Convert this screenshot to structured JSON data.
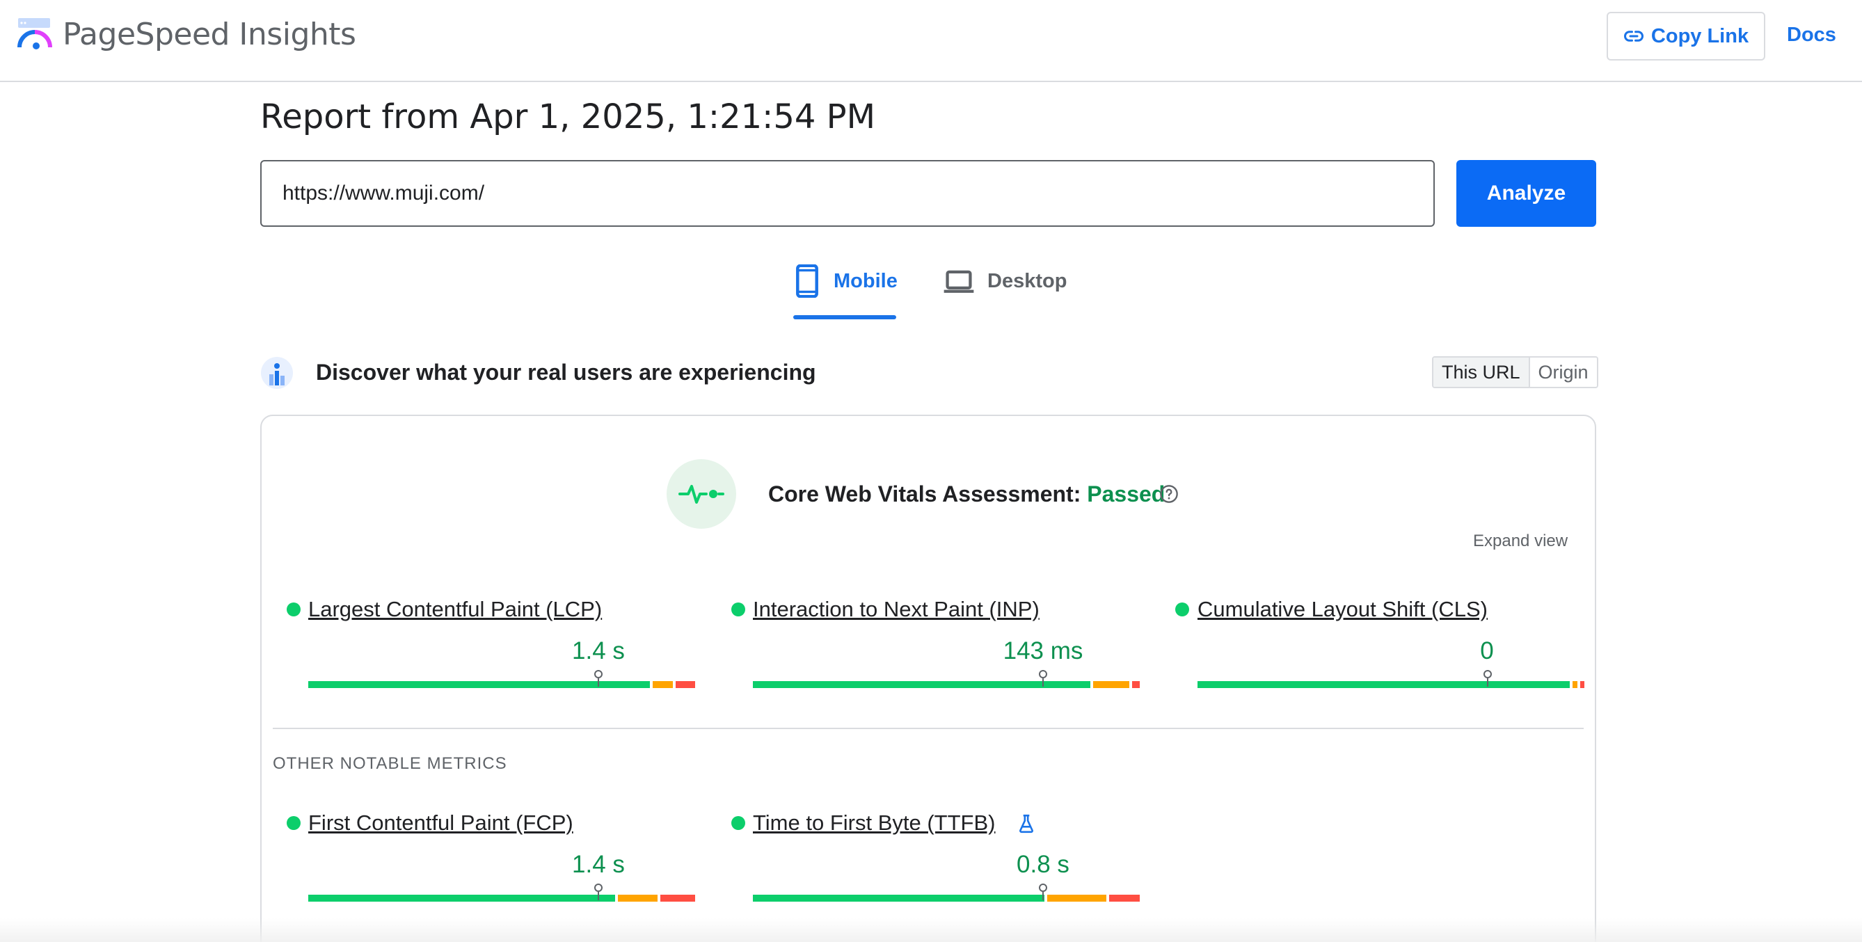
{
  "header": {
    "brand": "PageSpeed Insights",
    "copy_link_label": "Copy Link",
    "docs_label": "Docs"
  },
  "report": {
    "title": "Report from Apr 1, 2025, 1:21:54 PM"
  },
  "search": {
    "url_value": "https://www.muji.com/",
    "analyze_label": "Analyze"
  },
  "tabs": [
    {
      "label": "Mobile",
      "active": true
    },
    {
      "label": "Desktop",
      "active": false
    }
  ],
  "discover": {
    "title": "Discover what your real users are experiencing",
    "toggle": [
      "This URL",
      "Origin"
    ]
  },
  "assessment": {
    "label": "Core Web Vitals Assessment:",
    "status": "Passed",
    "expand_label": "Expand view"
  },
  "core_metrics": [
    {
      "name": "Largest Contentful Paint (LCP)",
      "value": "1.4 s",
      "distribution": {
        "good": 0.89,
        "needs_improvement": 0.06,
        "poor": 0.05
      },
      "p75_fraction": 0.75
    },
    {
      "name": "Interaction to Next Paint (INP)",
      "value": "143 ms",
      "distribution": {
        "good": 0.88,
        "needs_improvement": 0.1,
        "poor": 0.02
      },
      "p75_fraction": 0.75
    },
    {
      "name": "Cumulative Layout Shift (CLS)",
      "value": "0",
      "distribution": {
        "good": 0.97,
        "needs_improvement": 0.02,
        "poor": 0.01
      },
      "p75_fraction": 0.75
    }
  ],
  "other_metrics": {
    "title": "OTHER NOTABLE METRICS",
    "items": [
      {
        "name": "First Contentful Paint (FCP)",
        "value": "1.4 s",
        "distribution": {
          "good": 0.8,
          "needs_improvement": 0.11,
          "poor": 0.09
        },
        "p75_fraction": 0.75,
        "experimental": false
      },
      {
        "name": "Time to First Byte (TTFB)",
        "value": "0.8 s",
        "distribution": {
          "good": 0.76,
          "needs_improvement": 0.16,
          "poor": 0.08
        },
        "p75_fraction": 0.75,
        "experimental": true
      }
    ]
  },
  "colors": {
    "accent": "#1a73e8",
    "good": "#0cce6b",
    "needs_improvement": "#ffa400",
    "poor": "#ff4e42",
    "passed_text": "#0d904f"
  }
}
